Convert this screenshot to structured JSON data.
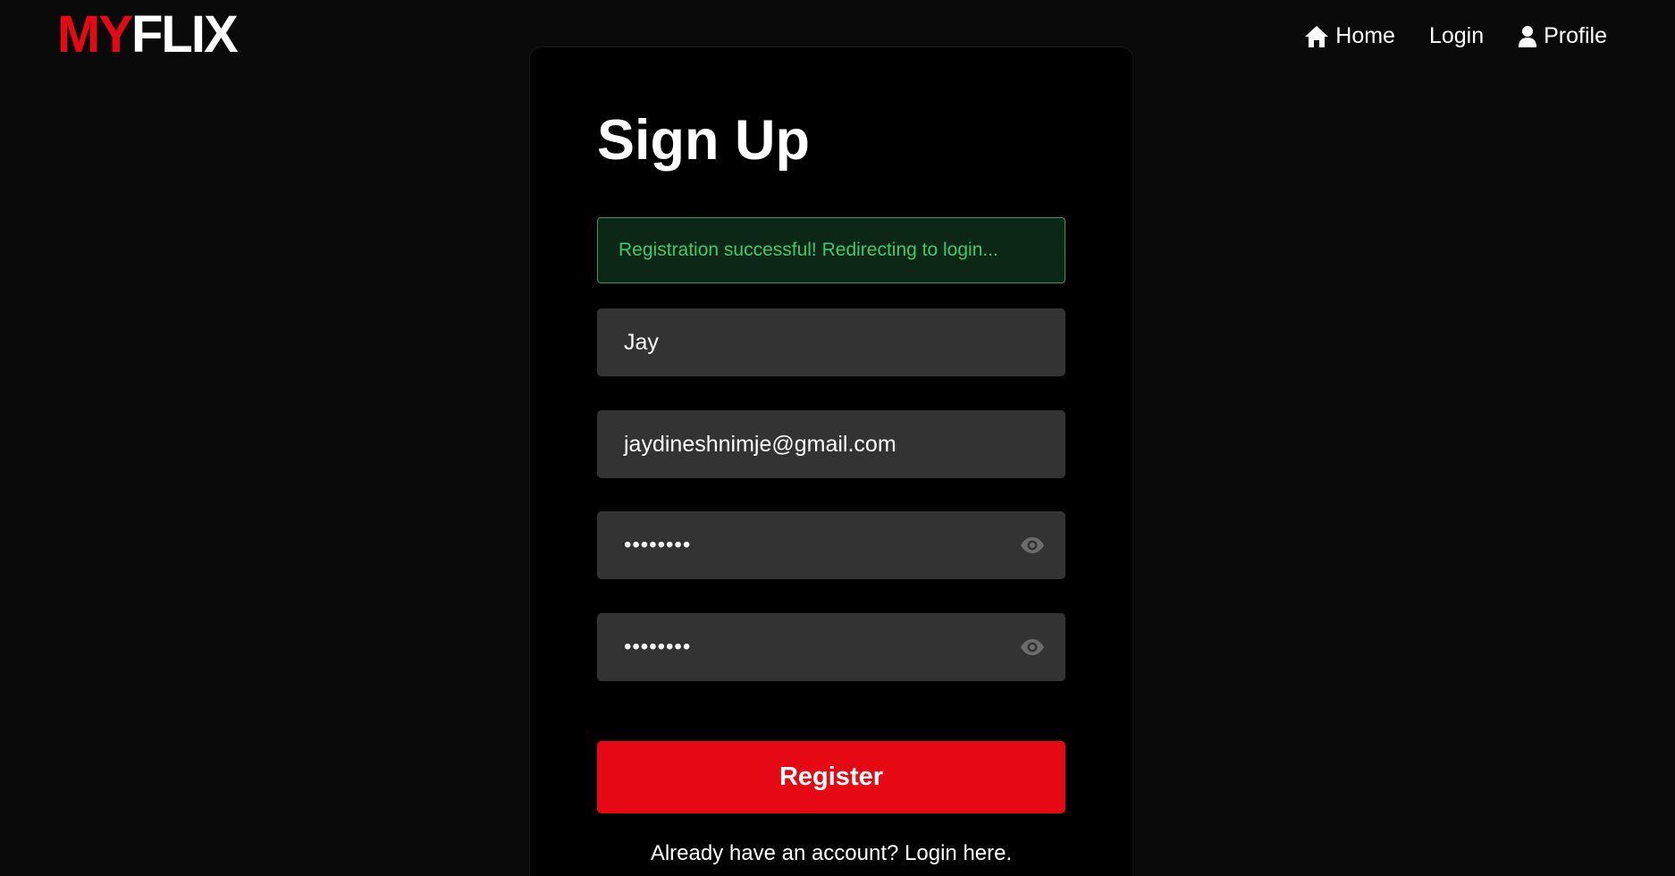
{
  "brand": {
    "part1": "MY",
    "part2": "FLIX"
  },
  "nav": {
    "home": {
      "label": "Home",
      "icon": "home-icon"
    },
    "login": {
      "label": "Login"
    },
    "profile": {
      "label": "Profile",
      "icon": "user-icon"
    }
  },
  "form": {
    "title": "Sign Up",
    "alert": "Registration successful! Redirecting to login...",
    "name_value": "Jay",
    "email_value": "jaydineshnimje@gmail.com",
    "password_value": "••••••••",
    "confirm_password_value": "••••••••",
    "submit_label": "Register",
    "footer_prefix": "Already have an account?",
    "footer_link": "Login here."
  },
  "colors": {
    "accent": "#e50914",
    "success_text": "#3ec96b",
    "success_bg": "#0c2715",
    "input_bg": "#333333"
  }
}
